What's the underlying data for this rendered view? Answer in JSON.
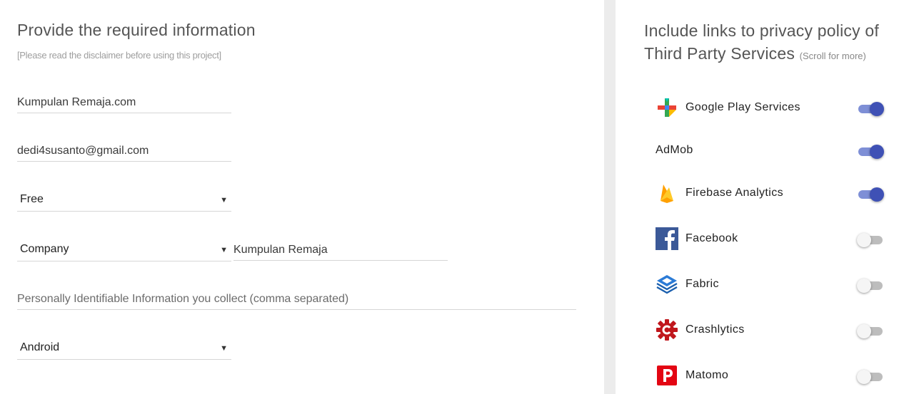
{
  "form": {
    "title": "Provide the required information",
    "subtitle": "[Please read the disclaimer before using this project]",
    "app_name_value": "Kumpulan Remaja.com",
    "email_value": "dedi4susanto@gmail.com",
    "app_type_select": "Free",
    "owner_type_select": "Company",
    "owner_name_value": "Kumpulan Remaja",
    "pii_placeholder": "Personally Identifiable Information you collect (comma separated)",
    "platform_select": "Android",
    "select_arrow": "▼"
  },
  "services_panel": {
    "title": "Include links to privacy policy of Third Party Services",
    "hint": "(Scroll for more)",
    "accent_color": "#3f51b5",
    "items": [
      {
        "label": "Google Play Services",
        "icon": "google-play-icon",
        "enabled": true
      },
      {
        "label": "AdMob",
        "icon": "",
        "enabled": true
      },
      {
        "label": "Firebase Analytics",
        "icon": "firebase-icon",
        "enabled": true
      },
      {
        "label": "Facebook",
        "icon": "facebook-icon",
        "enabled": false
      },
      {
        "label": "Fabric",
        "icon": "fabric-icon",
        "enabled": false
      },
      {
        "label": "Crashlytics",
        "icon": "crashlytics-icon",
        "enabled": false
      },
      {
        "label": "Matomo",
        "icon": "matomo-icon",
        "enabled": false
      }
    ]
  }
}
